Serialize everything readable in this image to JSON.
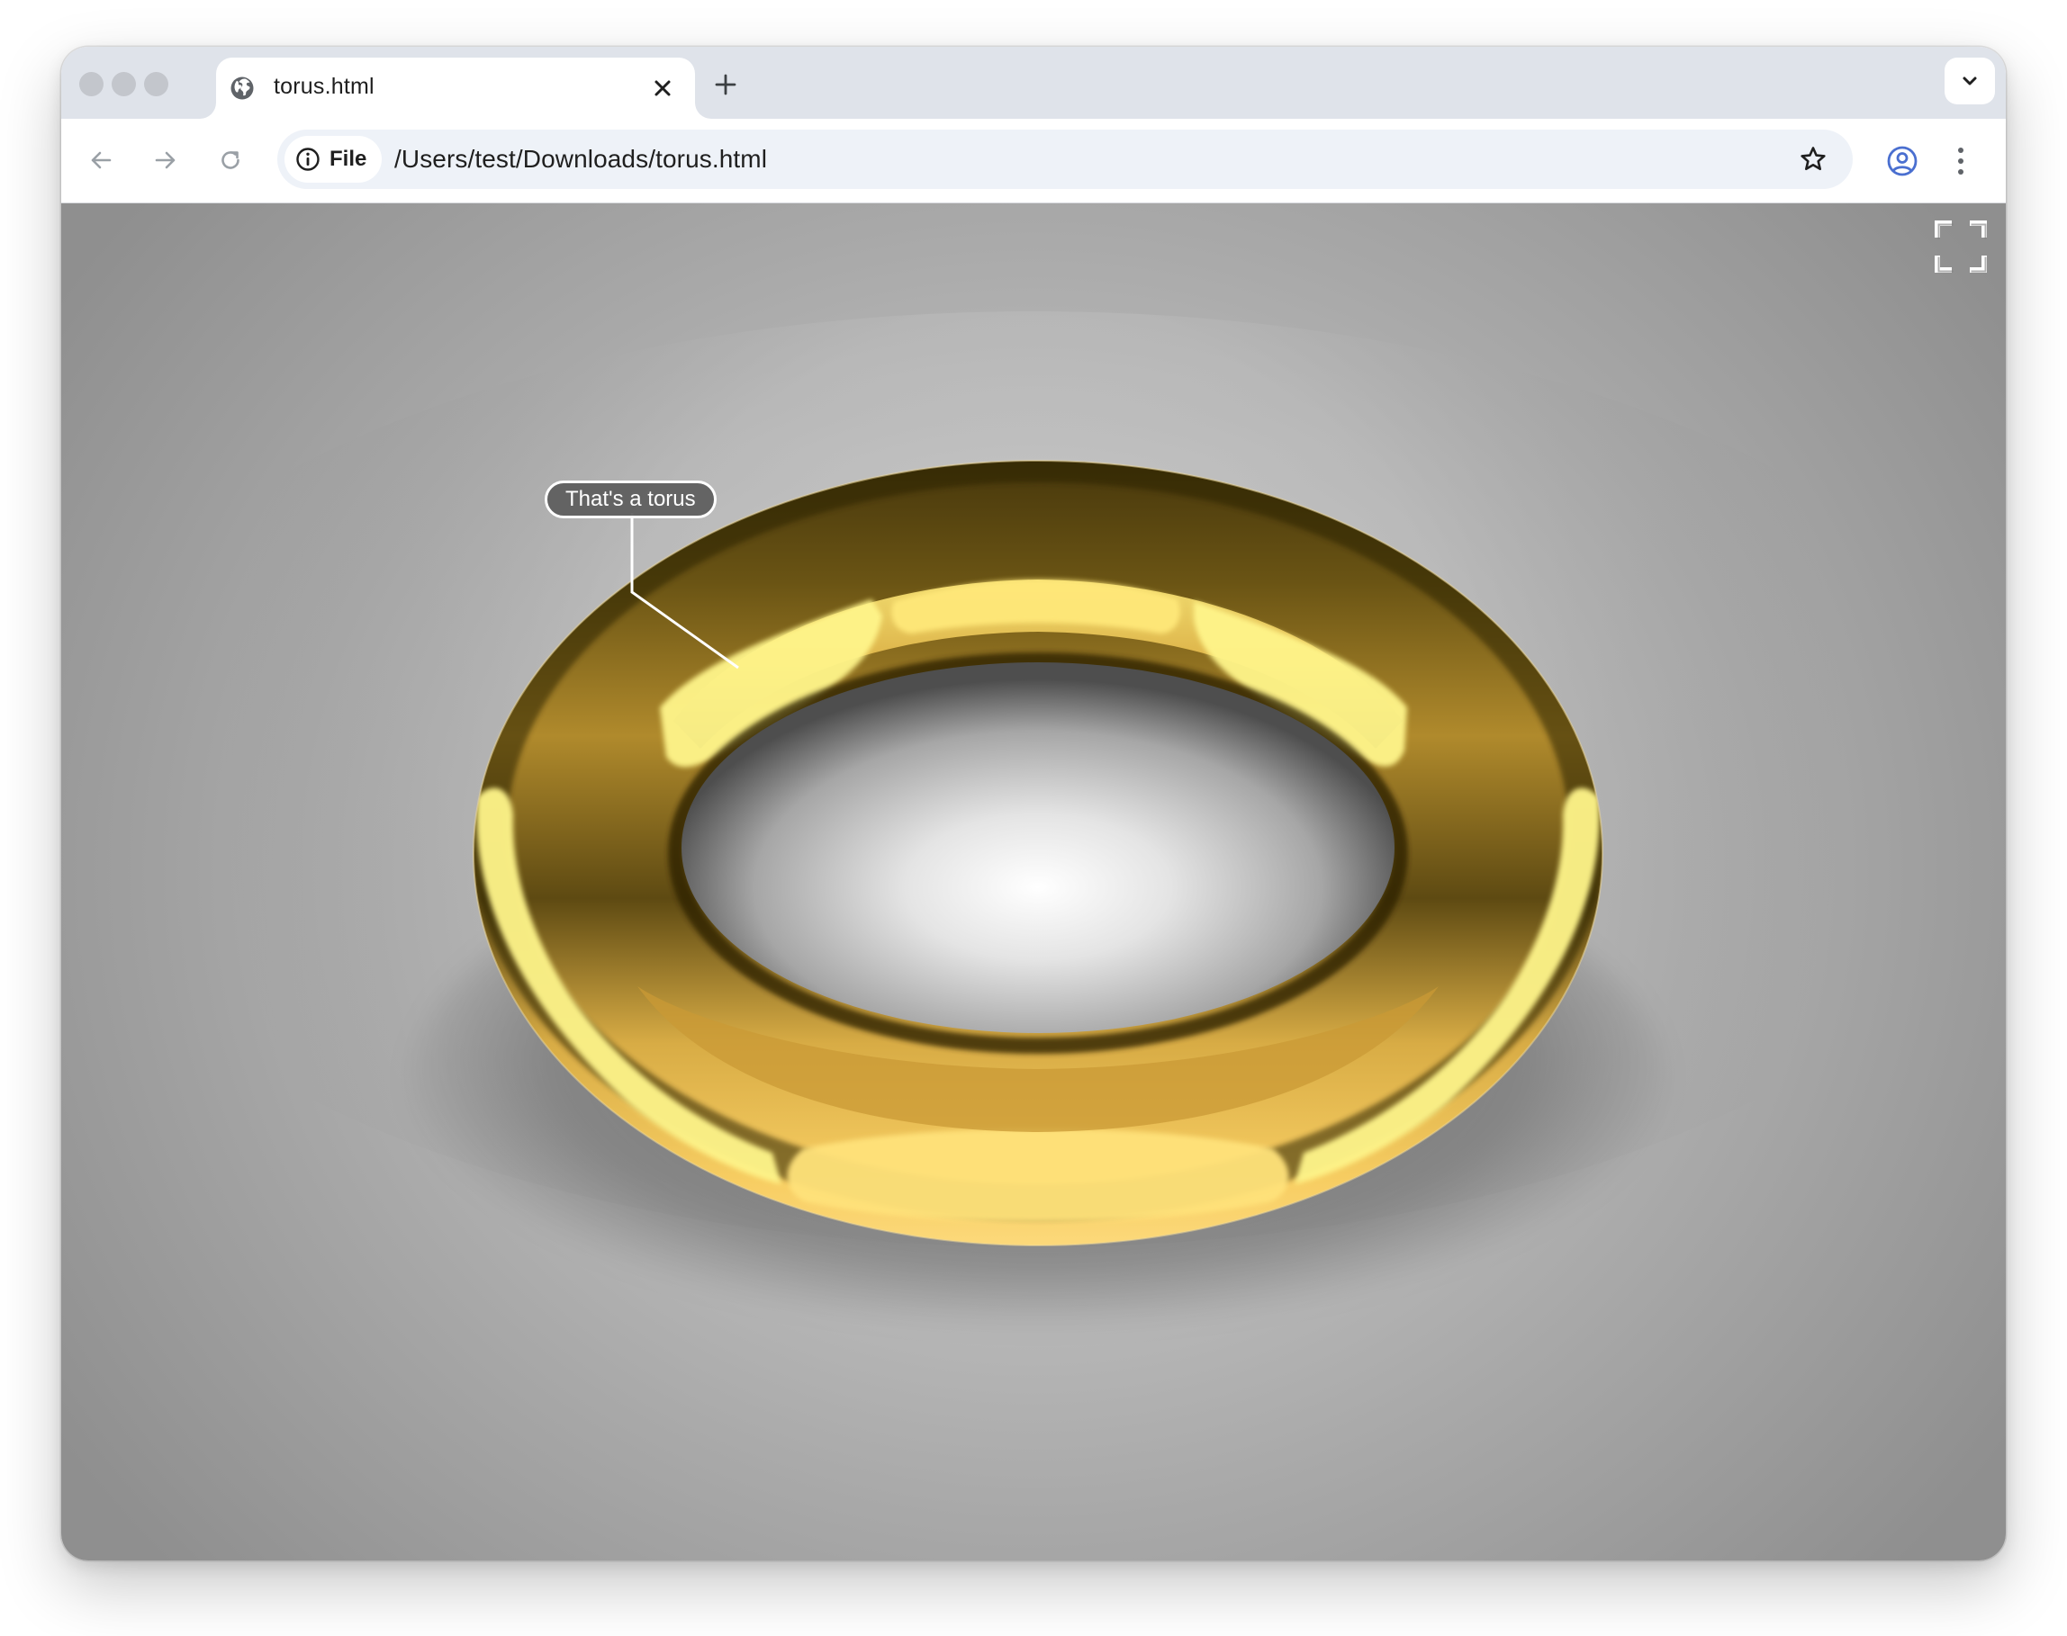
{
  "browser": {
    "tab": {
      "title": "torus.html",
      "favicon": "globe-icon",
      "close_icon": "close-icon"
    },
    "new_tab_icon": "plus-icon",
    "tab_search_icon": "chevron-down-icon",
    "toolbar": {
      "back_icon": "arrow-left-icon",
      "forward_icon": "arrow-right-icon",
      "reload_icon": "reload-icon",
      "site_info_chip": {
        "icon": "info-icon",
        "label": "File"
      },
      "url": "/Users/test/Downloads/torus.html",
      "bookmark_icon": "star-icon",
      "profile_icon": "profile-icon",
      "menu_icon": "more-vertical-icon"
    }
  },
  "viewer": {
    "fullscreen_icon": "fullscreen-icon",
    "annotation": {
      "label": "That's a torus"
    },
    "colors": {
      "background": "#bdbdbd",
      "torus_gold": "#e8b84a",
      "torus_highlight": "#fff68a",
      "torus_shadow": "#4a3a0a"
    }
  }
}
